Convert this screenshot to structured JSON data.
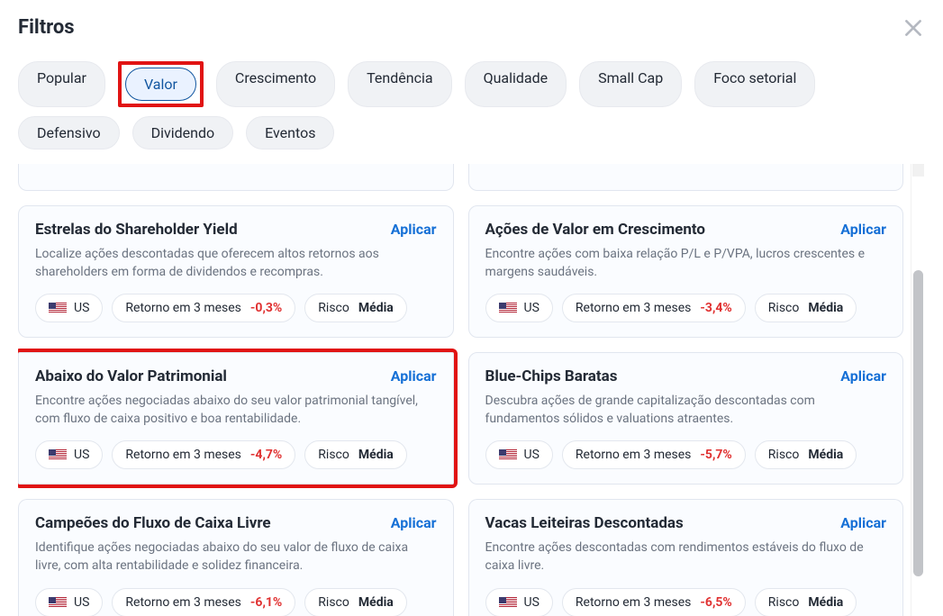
{
  "header": {
    "title": "Filtros"
  },
  "tabs": [
    {
      "label": "Popular",
      "active": false
    },
    {
      "label": "Valor",
      "active": true,
      "highlighted": true
    },
    {
      "label": "Crescimento",
      "active": false
    },
    {
      "label": "Tendência",
      "active": false
    },
    {
      "label": "Qualidade",
      "active": false
    },
    {
      "label": "Small Cap",
      "active": false
    },
    {
      "label": "Foco setorial",
      "active": false
    },
    {
      "label": "Defensivo",
      "active": false
    },
    {
      "label": "Dividendo",
      "active": false
    },
    {
      "label": "Eventos",
      "active": false
    }
  ],
  "labels": {
    "apply": "Aplicar",
    "return_prefix": "Retorno em 3 meses",
    "risk_prefix": "Risco",
    "risk_value": "Média",
    "region": "US"
  },
  "cards": [
    {
      "title": "Estrelas do Shareholder Yield",
      "desc": "Localize ações descontadas que oferecem altos retornos aos shareholders em forma de dividendos e recompras.",
      "ret": "-0,3%"
    },
    {
      "title": "Ações de Valor em Crescimento",
      "desc": "Encontre ações com baixa relação P/L e P/VPA, lucros crescentes e margens saudáveis.",
      "ret": "-3,4%"
    },
    {
      "title": "Abaixo do Valor Patrimonial",
      "desc": "Encontre ações negociadas abaixo do seu valor patrimonial tangível, com fluxo de caixa positivo e boa rentabilidade.",
      "ret": "-4,7%",
      "highlighted": true
    },
    {
      "title": "Blue-Chips Baratas",
      "desc": "Descubra ações de grande capitalização descontadas com fundamentos sólidos e valuations atraentes.",
      "ret": "-5,7%"
    },
    {
      "title": "Campeões do Fluxo de Caixa Livre",
      "desc": "Identifique ações negociadas abaixo do seu valor de fluxo de caixa livre, com alta rentabilidade e solidez financeira.",
      "ret": "-6,1%"
    },
    {
      "title": "Vacas Leiteiras Descontadas",
      "desc": "Encontre ações descontadas com rendimentos estáveis do fluxo de caixa livre.",
      "ret": "-6,5%"
    }
  ]
}
